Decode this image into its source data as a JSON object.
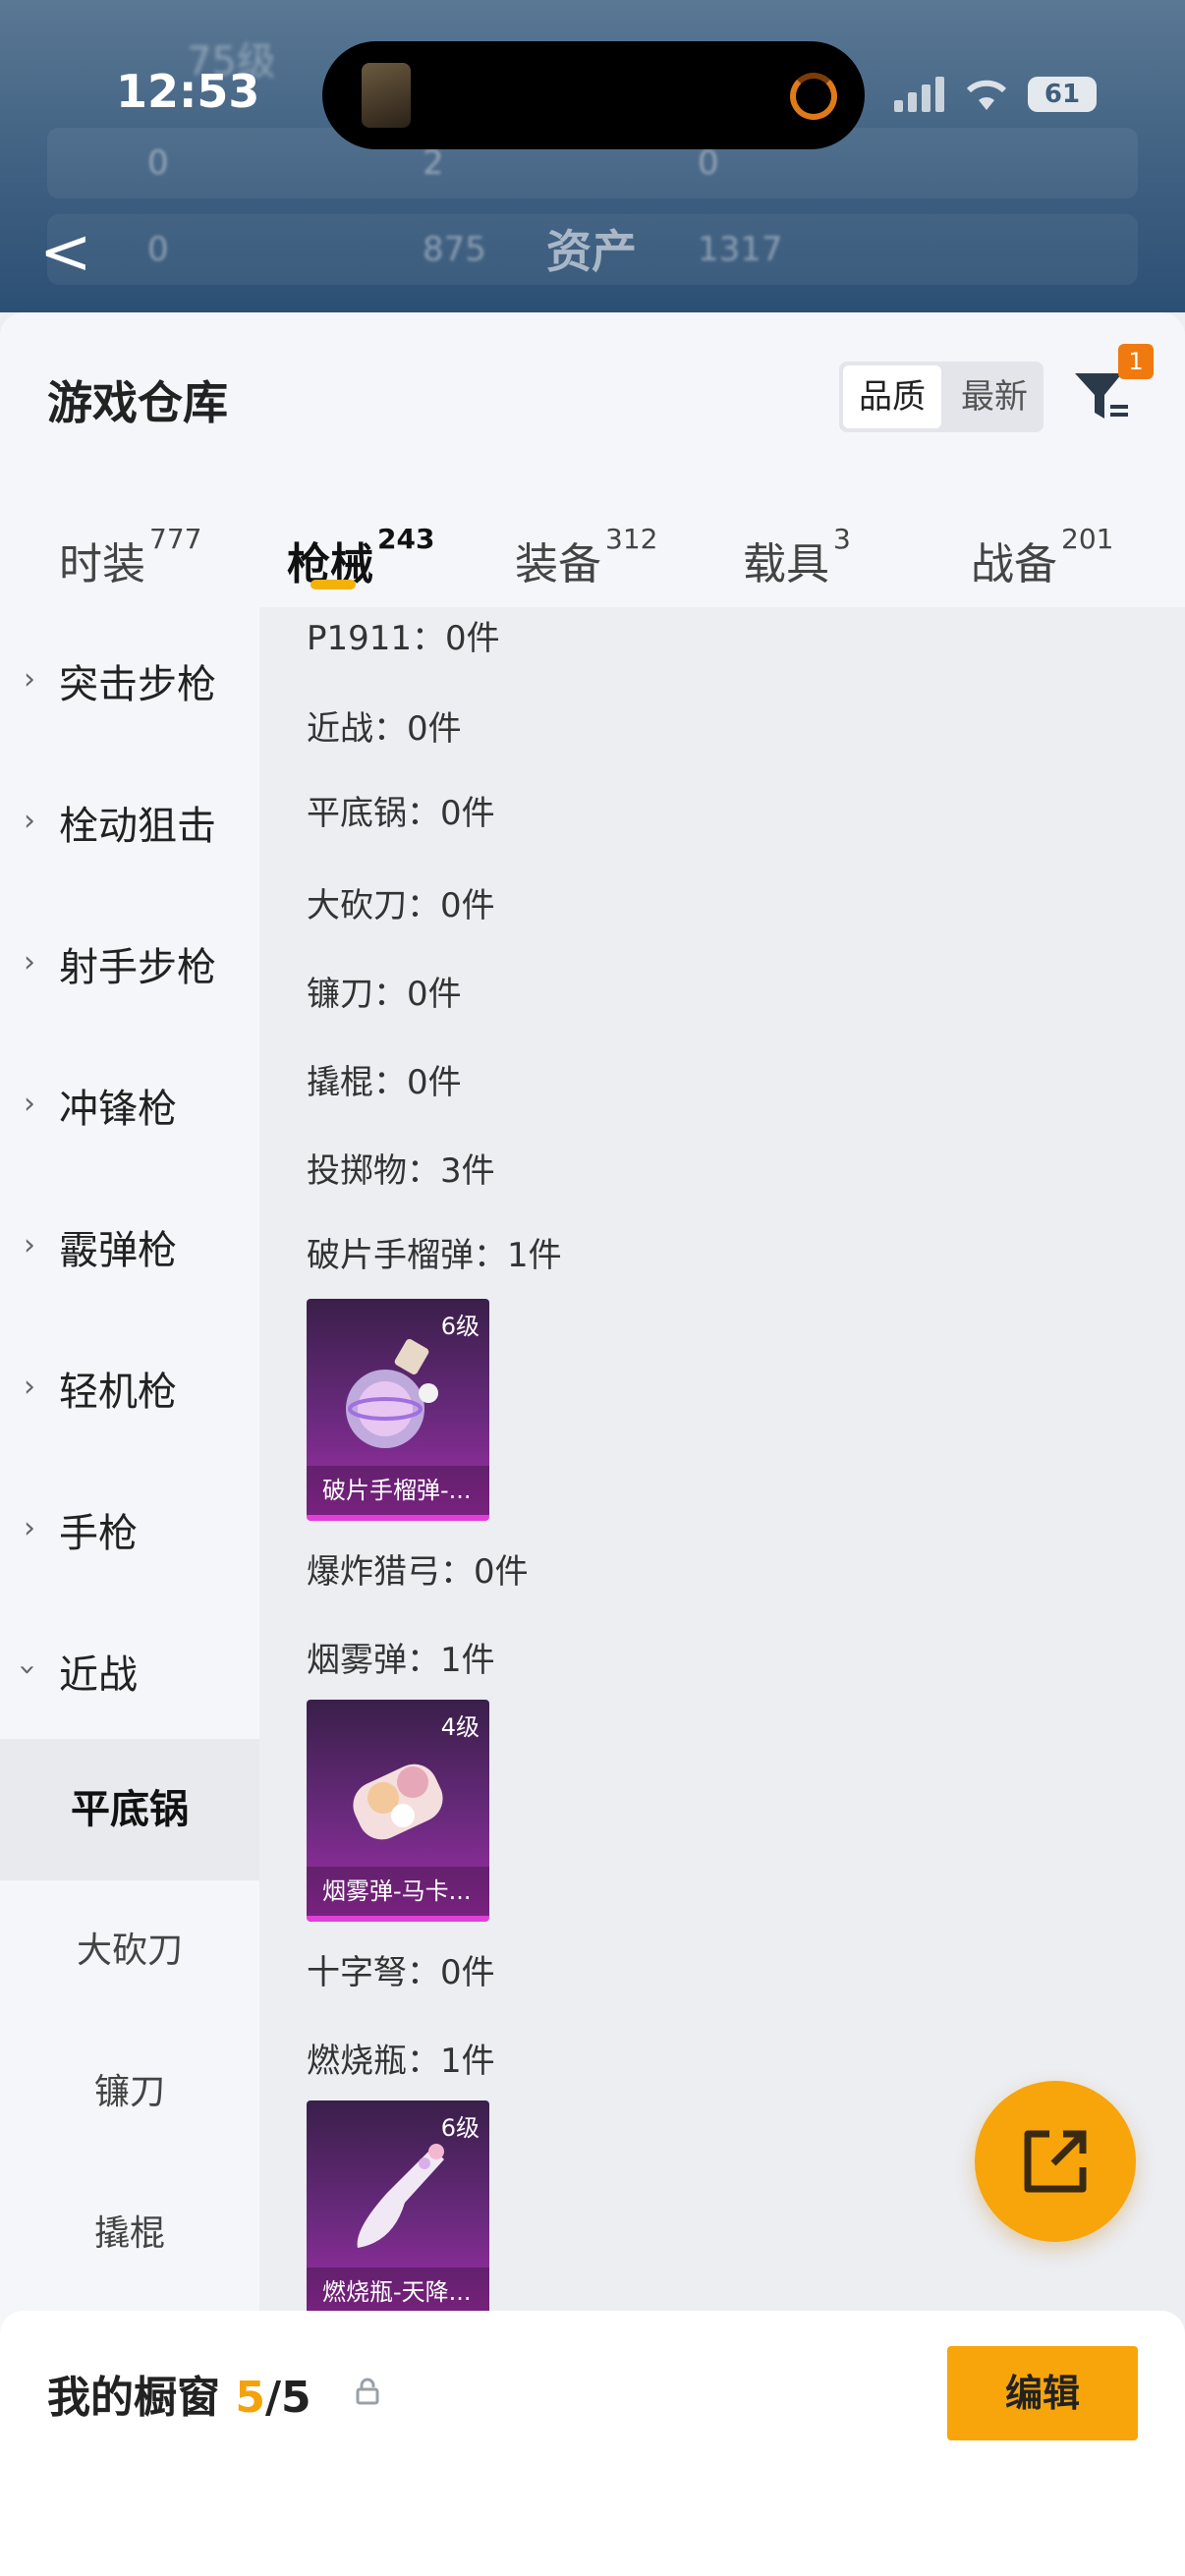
{
  "status": {
    "time": "12:53",
    "battery": "61"
  },
  "header": {
    "back_label": "<",
    "title": "资产",
    "level_text": "75级",
    "stats": [
      "0",
      "2",
      "0",
      "0",
      "875",
      "1317"
    ]
  },
  "sheet": {
    "title": "游戏仓库",
    "sort_options": [
      "品质",
      "最新"
    ],
    "selected_sort": "品质",
    "filter_badge": "1"
  },
  "tabs": [
    {
      "label": "时装",
      "count": "777"
    },
    {
      "label": "枪械",
      "count": "243"
    },
    {
      "label": "装备",
      "count": "312"
    },
    {
      "label": "载具",
      "count": "3"
    },
    {
      "label": "战备",
      "count": "201"
    }
  ],
  "active_tab": "枪械",
  "sidebar": {
    "categories": [
      "突击步枪",
      "栓动狙击",
      "射手步枪",
      "冲锋枪",
      "霰弹枪",
      "轻机枪",
      "手枪",
      "近战"
    ],
    "subitems": [
      "平底锅",
      "大砍刀",
      "镰刀",
      "撬棍"
    ],
    "selected_sub": "平底锅"
  },
  "content": {
    "lines": [
      "P1911：0件",
      "近战：0件",
      "平底锅：0件",
      "大砍刀：0件",
      "镰刀：0件",
      "撬棍：0件",
      "投掷物：3件",
      "破片手榴弹：1件",
      "爆炸猎弓：0件",
      "烟雾弹：1件",
      "十字弩：0件",
      "燃烧瓶：1件"
    ],
    "cards": [
      {
        "level": "6级",
        "name": "破片手榴弹-..."
      },
      {
        "level": "4级",
        "name": "烟雾弹-马卡..."
      },
      {
        "level": "6级",
        "name": "燃烧瓶-天降..."
      }
    ]
  },
  "showcase": {
    "label": "我的橱窗",
    "current": "5",
    "total": "/5",
    "edit_label": "编辑"
  },
  "colors": {
    "accent": "#f7a50a",
    "card_purple": "#a02ea8",
    "tab_indicator": "#f3b10a"
  }
}
